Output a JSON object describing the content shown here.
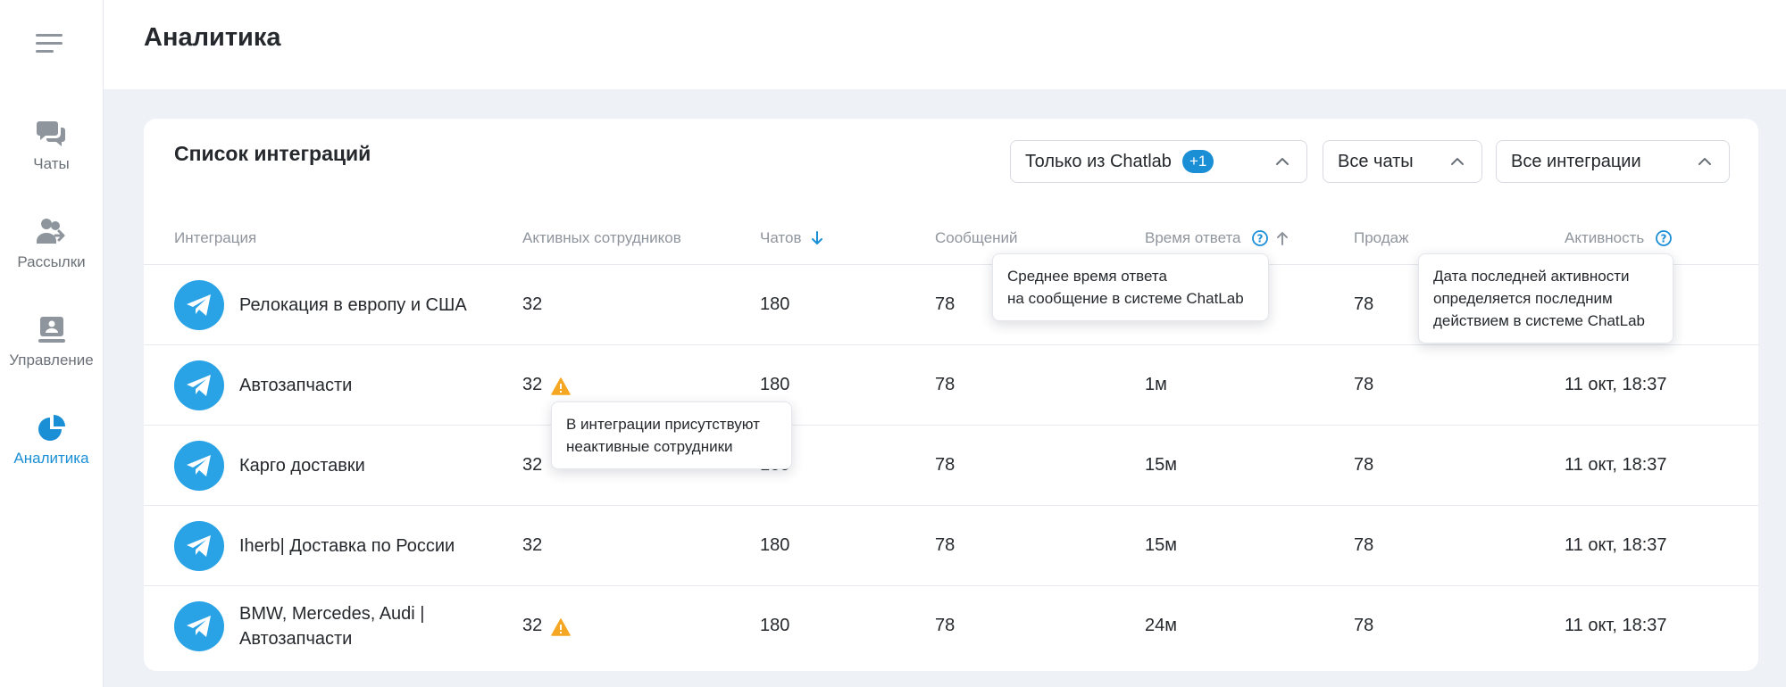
{
  "sidebar": {
    "items": [
      {
        "label": "Чаты",
        "icon": "chat-bubbles-icon",
        "active": false
      },
      {
        "label": "Рассылки",
        "icon": "users-send-icon",
        "active": false
      },
      {
        "label": "Управление",
        "icon": "management-board-icon",
        "active": false
      },
      {
        "label": "Аналитика",
        "icon": "pie-chart-icon",
        "active": true
      }
    ]
  },
  "header": {
    "title": "Аналитика"
  },
  "card": {
    "title": "Список интеграций",
    "filters": {
      "source": {
        "label": "Только из Chatlab",
        "badge": "+1"
      },
      "chats": {
        "label": "Все чаты"
      },
      "integrations": {
        "label": "Все интеграции"
      }
    },
    "columns": {
      "integration": "Интеграция",
      "active_employees": "Активных сотрудников",
      "chats": "Чатов",
      "messages": "Сообщений",
      "response_time": "Время ответа",
      "sales": "Продаж",
      "activity": "Активность"
    },
    "rows": [
      {
        "name": "Релокация в европу и США",
        "employees": "32",
        "warning": false,
        "chats": "180",
        "messages": "78",
        "response_time": "",
        "sales": "78",
        "activity": ""
      },
      {
        "name": "Автозапчасти",
        "employees": "32",
        "warning": true,
        "chats": "180",
        "messages": "78",
        "response_time": "1м",
        "sales": "78",
        "activity": "11 окт, 18:37"
      },
      {
        "name": "Карго доставки",
        "employees": "32",
        "warning": false,
        "chats": "180",
        "messages": "78",
        "response_time": "15м",
        "sales": "78",
        "activity": "11 окт, 18:37"
      },
      {
        "name": "Iherb| Доставка по России",
        "employees": "32",
        "warning": false,
        "chats": "180",
        "messages": "78",
        "response_time": "15м",
        "sales": "78",
        "activity": "11 окт, 18:37"
      },
      {
        "name": "BMW, Mercedes, Audi | Автозапчасти",
        "employees": "32",
        "warning": true,
        "chats": "180",
        "messages": "78",
        "response_time": "24м",
        "sales": "78",
        "activity": "11 окт, 18:37"
      }
    ]
  },
  "tooltips": {
    "response_time": {
      "line1": "Среднее время ответа",
      "line2": "на сообщение в системе ChatLab"
    },
    "activity": {
      "line1": "Дата последней активности",
      "line2": "определяется последним",
      "line3": "действием в системе ChatLab"
    },
    "inactive": {
      "line1": "В интеграции присутствуют",
      "line2": "неактивные сотрудники"
    }
  },
  "colors": {
    "accent": "#1a8fd6",
    "telegram": "#2aa3e6",
    "warning": "#f5a623",
    "background": "#eef1f5"
  }
}
